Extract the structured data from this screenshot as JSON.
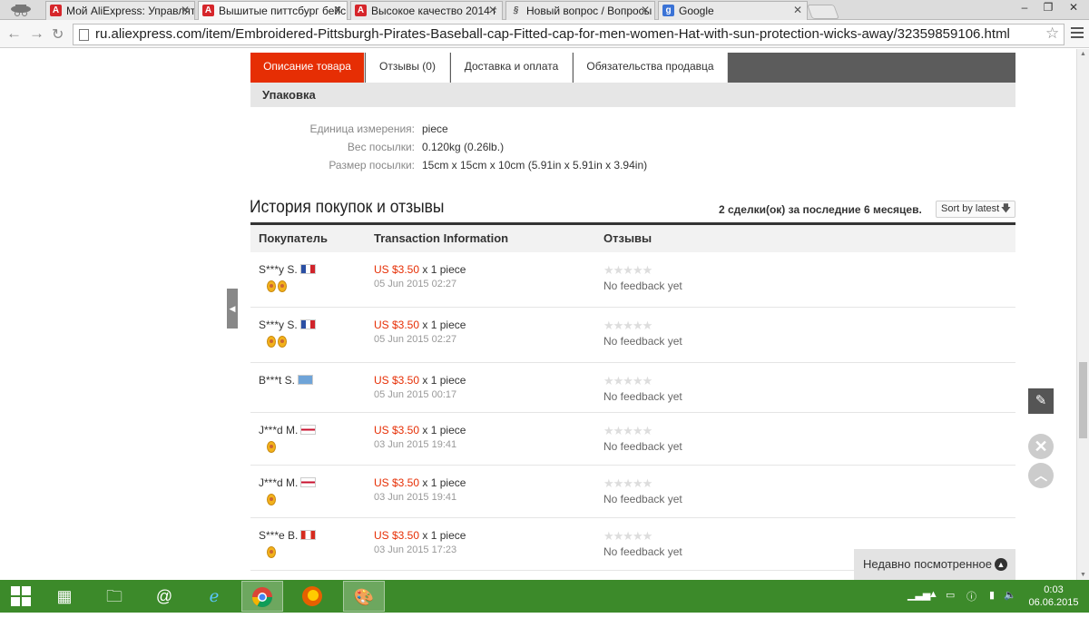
{
  "browser": {
    "tabs": [
      {
        "label": "Мой AliExpress: Управлят",
        "favicon": "aliexpress-icon",
        "active": false
      },
      {
        "label": "Вышитые питтсбург бейс",
        "favicon": "aliexpress-icon",
        "active": true
      },
      {
        "label": "Высокое качество 2014 г",
        "favicon": "aliexpress-icon",
        "active": false
      },
      {
        "label": "Новый вопрос / Вопросы",
        "favicon": "question-icon",
        "active": false
      },
      {
        "label": "Google",
        "favicon": "google-icon",
        "active": false
      }
    ],
    "google_favicon_letter": "g",
    "url": "ru.aliexpress.com/item/Embroidered-Pittsburgh-Pirates-Baseball-cap-Fitted-cap-for-men-women-Hat-with-sun-protection-wicks-away/32359859106.html"
  },
  "detail_tabs": [
    {
      "label": "Описание товара",
      "active": true
    },
    {
      "label": "Отзывы (0)",
      "active": false
    },
    {
      "label": "Доставка и оплата",
      "active": false
    },
    {
      "label": "Обязательства продавца",
      "active": false
    }
  ],
  "packaging": {
    "heading": "Упаковка",
    "rows": [
      {
        "label": "Единица измерения:",
        "value": "piece"
      },
      {
        "label": "Вес посылки:",
        "value": "0.120kg (0.26lb.)"
      },
      {
        "label": "Размер посылки:",
        "value": "15cm x 15cm x 10cm (5.91in x 5.91in x 3.94in)"
      }
    ]
  },
  "history": {
    "title": "История покупок и отзывы",
    "deal_count": "2 сделки(ок) за последние 6 месяцев.",
    "sort_label": "Sort by latest",
    "columns": [
      "Покупатель",
      "Transaction Information",
      "Отзывы"
    ],
    "rows": [
      {
        "buyer": "S***y S.",
        "flag": "France",
        "medals": 2,
        "price": "US $3.50",
        "qty": "x 1 piece",
        "date": "05 Jun 2015 02:27",
        "feedback": "No feedback yet"
      },
      {
        "buyer": "S***y S.",
        "flag": "France",
        "medals": 2,
        "price": "US $3.50",
        "qty": "x 1 piece",
        "date": "05 Jun 2015 02:27",
        "feedback": "No feedback yet"
      },
      {
        "buyer": "B***t S.",
        "flag": "Israel",
        "medals": 0,
        "price": "US $3.50",
        "qty": "x 1 piece",
        "date": "05 Jun 2015 00:17",
        "feedback": "No feedback yet"
      },
      {
        "buyer": "J***d M.",
        "flag": "United Kingdom",
        "medals": 1,
        "price": "US $3.50",
        "qty": "x 1 piece",
        "date": "03 Jun 2015 19:41",
        "feedback": "No feedback yet"
      },
      {
        "buyer": "J***d M.",
        "flag": "United Kingdom",
        "medals": 1,
        "price": "US $3.50",
        "qty": "x 1 piece",
        "date": "03 Jun 2015 19:41",
        "feedback": "No feedback yet"
      },
      {
        "buyer": "S***e B.",
        "flag": "Canada",
        "medals": 1,
        "price": "US $3.50",
        "qty": "x 1 piece",
        "date": "03 Jun 2015 17:23",
        "feedback": "No feedback yet"
      }
    ]
  },
  "recently_viewed": "Недавно посмотренное",
  "taskbar": {
    "time": "0:03",
    "date": "06.06.2015"
  },
  "colors": {
    "accent": "#e62e04",
    "taskbar": "#3c8a2a"
  }
}
